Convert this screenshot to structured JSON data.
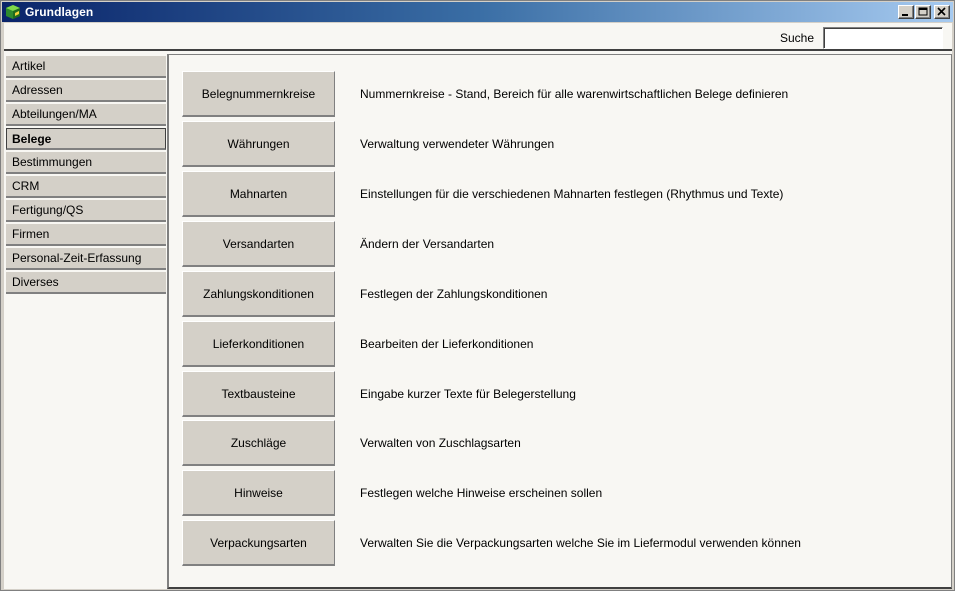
{
  "window": {
    "title": "Grundlagen"
  },
  "search": {
    "label": "Suche",
    "value": "",
    "placeholder": ""
  },
  "sidebar": {
    "items": [
      {
        "label": "Artikel",
        "active": false
      },
      {
        "label": "Adressen",
        "active": false
      },
      {
        "label": "Abteilungen/MA",
        "active": false
      },
      {
        "label": "Belege",
        "active": true
      },
      {
        "label": "Bestimmungen",
        "active": false
      },
      {
        "label": "CRM",
        "active": false
      },
      {
        "label": "Fertigung/QS",
        "active": false
      },
      {
        "label": "Firmen",
        "active": false
      },
      {
        "label": "Personal-Zeit-Erfassung",
        "active": false
      },
      {
        "label": "Diverses",
        "active": false
      }
    ]
  },
  "main": {
    "rows": [
      {
        "button": "Belegnummernkreise",
        "description": "Nummernkreise - Stand, Bereich für alle warenwirtschaftlichen Belege definieren"
      },
      {
        "button": "Währungen",
        "description": "Verwaltung verwendeter Währungen"
      },
      {
        "button": "Mahnarten",
        "description": "Einstellungen für die verschiedenen Mahnarten festlegen (Rhythmus und Texte)"
      },
      {
        "button": "Versandarten",
        "description": "Ändern der Versandarten"
      },
      {
        "button": "Zahlungskonditionen",
        "description": "Festlegen der Zahlungskonditionen"
      },
      {
        "button": "Lieferkonditionen",
        "description": "Bearbeiten der Lieferkonditionen"
      },
      {
        "button": "Textbausteine",
        "description": "Eingabe kurzer Texte für Belegerstellung"
      },
      {
        "button": "Zuschläge",
        "description": "Verwalten von Zuschlagsarten"
      },
      {
        "button": "Hinweise",
        "description": "Festlegen welche Hinweise erscheinen sollen"
      },
      {
        "button": "Verpackungsarten",
        "description": "Verwalten Sie die Verpackungsarten welche Sie im Liefermodul verwenden können"
      }
    ]
  },
  "icons": {
    "app": "green-cube-icon",
    "minimize": "minimize-icon",
    "maximize": "maximize-icon",
    "close": "close-icon"
  }
}
